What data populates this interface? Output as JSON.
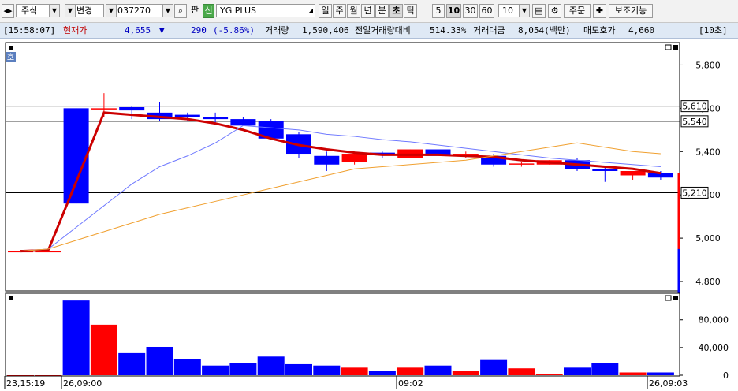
{
  "toolbar": {
    "nav_arrows": "◂▸",
    "market": "주식",
    "change_label": "변경",
    "code": "037270",
    "search_icon": "⌕",
    "pan_label": "판",
    "sin_badge": "신",
    "stock_name": "YG PLUS",
    "period_tabs": [
      "일",
      "주",
      "월",
      "년",
      "분",
      "초",
      "틱"
    ],
    "selected_tab": "초",
    "interval_buttons": [
      "5",
      "10",
      "30",
      "60"
    ],
    "selected_interval": "10",
    "interval_value": "10",
    "order_label": "주문",
    "indicator_label": "보조기능"
  },
  "info": {
    "time": "[15:58:07]",
    "price_label": "현재가",
    "price": "4,655",
    "arrow": "▼",
    "change": "290",
    "change_pct": "(-5.86%)",
    "volume_label": "거래량",
    "volume": "1,590,406",
    "prev_volume_label": "전일거래량대비",
    "prev_volume_ratio": "514.33%",
    "amount_label": "거래대금",
    "amount": "8,054(백만)",
    "ask_label": "매도호가",
    "ask": "4,660",
    "period": "[10초]"
  },
  "colors": {
    "up": "#ff0000",
    "down": "#0000ff",
    "ma_thick": "#cc0000",
    "ma_blue": "#6f79ff",
    "ma_orange": "#f0a030",
    "info_up": "#c00000",
    "info_down": "#0000c0",
    "info_bg": "#dfe9f5"
  },
  "price_panel": {
    "side_label": "호",
    "y_ticks": [
      "5,800",
      "5,600",
      "5,400",
      "5,200",
      "5,000",
      "4,800"
    ],
    "hlines": [
      {
        "value": 5610,
        "label": "5,610"
      },
      {
        "value": 5540,
        "label": "5,540"
      },
      {
        "value": 5210,
        "label": "5,210"
      }
    ]
  },
  "volume_panel": {
    "y_ticks": [
      "80,000",
      "40,000",
      "0"
    ]
  },
  "x_labels": [
    "23,15:19",
    "26,09:00",
    "09:02",
    "26,09:03"
  ],
  "chart_data": [
    {
      "type": "candlestick",
      "ylim": [
        4760,
        5900
      ],
      "candles": [
        {
          "o": 4940,
          "h": 4945,
          "l": 4935,
          "c": 4940
        },
        {
          "o": 4940,
          "h": 4945,
          "l": 4935,
          "c": 4940
        },
        {
          "o": 5600,
          "h": 5600,
          "l": 5160,
          "c": 5160
        },
        {
          "o": 5600,
          "h": 5670,
          "l": 5560,
          "c": 5600
        },
        {
          "o": 5605,
          "h": 5610,
          "l": 5550,
          "c": 5590
        },
        {
          "o": 5580,
          "h": 5630,
          "l": 5540,
          "c": 5550
        },
        {
          "o": 5570,
          "h": 5580,
          "l": 5540,
          "c": 5560
        },
        {
          "o": 5560,
          "h": 5580,
          "l": 5530,
          "c": 5550
        },
        {
          "o": 5550,
          "h": 5560,
          "l": 5520,
          "c": 5520
        },
        {
          "o": 5540,
          "h": 5550,
          "l": 5460,
          "c": 5460
        },
        {
          "o": 5480,
          "h": 5490,
          "l": 5370,
          "c": 5390
        },
        {
          "o": 5380,
          "h": 5400,
          "l": 5310,
          "c": 5340
        },
        {
          "o": 5350,
          "h": 5400,
          "l": 5340,
          "c": 5390
        },
        {
          "o": 5395,
          "h": 5400,
          "l": 5370,
          "c": 5385
        },
        {
          "o": 5370,
          "h": 5410,
          "l": 5370,
          "c": 5410
        },
        {
          "o": 5410,
          "h": 5420,
          "l": 5370,
          "c": 5380
        },
        {
          "o": 5390,
          "h": 5400,
          "l": 5370,
          "c": 5390
        },
        {
          "o": 5380,
          "h": 5390,
          "l": 5330,
          "c": 5340
        },
        {
          "o": 5345,
          "h": 5350,
          "l": 5330,
          "c": 5345
        },
        {
          "o": 5340,
          "h": 5360,
          "l": 5340,
          "c": 5360
        },
        {
          "o": 5360,
          "h": 5370,
          "l": 5310,
          "c": 5320
        },
        {
          "o": 5320,
          "h": 5330,
          "l": 5260,
          "c": 5310
        },
        {
          "o": 5290,
          "h": 5310,
          "l": 5270,
          "c": 5310
        },
        {
          "o": 5300,
          "h": 5310,
          "l": 5270,
          "c": 5280
        }
      ],
      "ma_lines": [
        {
          "style": "thick",
          "values": [
            4940,
            4945,
            5260,
            5580,
            5570,
            5560,
            5550,
            5530,
            5500,
            5460,
            5430,
            5410,
            5395,
            5385,
            5385,
            5385,
            5380,
            5375,
            5360,
            5350,
            5340,
            5330,
            5320,
            5300
          ]
        },
        {
          "style": "blue",
          "values": [
            4940,
            4950,
            5050,
            5150,
            5250,
            5330,
            5380,
            5440,
            5520,
            5510,
            5500,
            5480,
            5470,
            5455,
            5445,
            5430,
            5415,
            5400,
            5385,
            5370,
            5360,
            5350,
            5340,
            5330
          ]
        },
        {
          "style": "orange",
          "values": [
            4940,
            4950,
            4990,
            5030,
            5070,
            5110,
            5140,
            5170,
            5200,
            5230,
            5260,
            5290,
            5320,
            5330,
            5340,
            5350,
            5360,
            5380,
            5400,
            5420,
            5440,
            5420,
            5400,
            5390
          ]
        }
      ],
      "volumes": [
        0,
        0,
        108000,
        73000,
        32000,
        41000,
        23000,
        14000,
        18000,
        27000,
        16000,
        14000,
        11000,
        6000,
        11000,
        14000,
        6000,
        22000,
        10000,
        2000,
        11000,
        18000,
        4000,
        4000
      ],
      "volume_ylim": [
        0,
        115000
      ],
      "current": {
        "price": 4655,
        "candle": {
          "o": 5300,
          "h": 5300,
          "l": 4620,
          "c": 4655
        }
      }
    }
  ]
}
